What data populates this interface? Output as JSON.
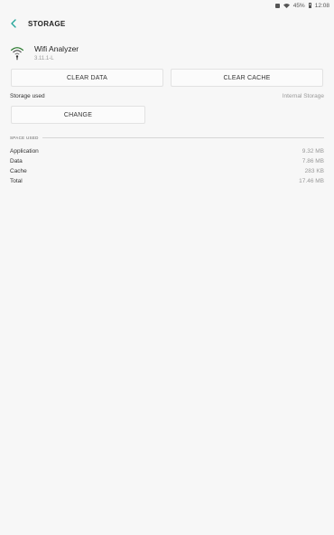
{
  "status_bar": {
    "battery": "45%",
    "time": "12:08",
    "icons": [
      "notification-icon",
      "wifi-icon",
      "battery-icon"
    ]
  },
  "header": {
    "title": "STORAGE",
    "back_icon": "back-arrow-icon",
    "accent_color": "#26a69a"
  },
  "app": {
    "name": "Wifi Analyzer",
    "version": "3.11.1-L",
    "icon": "wifi-analyzer-icon"
  },
  "buttons": {
    "clear_data": "CLEAR DATA",
    "clear_cache": "CLEAR CACHE",
    "change": "CHANGE"
  },
  "storage_used": {
    "label": "Storage used",
    "value": "Internal Storage"
  },
  "space_used": {
    "header": "SPACE USED",
    "rows": [
      {
        "label": "Application",
        "value": "9.32 MB"
      },
      {
        "label": "Data",
        "value": "7.86 MB"
      },
      {
        "label": "Cache",
        "value": "283 KB"
      },
      {
        "label": "Total",
        "value": "17.46 MB"
      }
    ]
  }
}
